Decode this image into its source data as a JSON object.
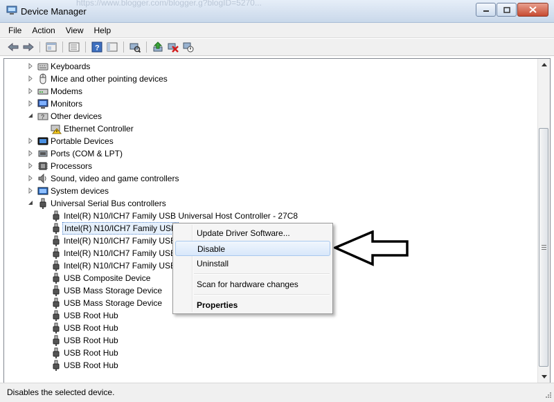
{
  "window": {
    "title": "Device Manager",
    "background_url_ghost": "https://www.blogger.com/blogger.g?blogID=5270..."
  },
  "menubar": {
    "items": [
      "File",
      "Action",
      "View",
      "Help"
    ]
  },
  "toolbar": {
    "icons": [
      "back-arrow-icon",
      "forward-arrow-icon",
      "properties-view-icon",
      "show-hide-tree-icon",
      "help-icon",
      "details-view-icon",
      "scan-hardware-icon",
      "update-driver-icon",
      "uninstall-icon",
      "disable-device-icon"
    ]
  },
  "tree": {
    "nodes": [
      {
        "label": "Keyboards",
        "level": 0,
        "expander": "collapsed",
        "icon": "keyboard-icon"
      },
      {
        "label": "Mice and other pointing devices",
        "level": 0,
        "expander": "collapsed",
        "icon": "mouse-icon"
      },
      {
        "label": "Modems",
        "level": 0,
        "expander": "collapsed",
        "icon": "modem-icon"
      },
      {
        "label": "Monitors",
        "level": 0,
        "expander": "collapsed",
        "icon": "monitor-icon"
      },
      {
        "label": "Other devices",
        "level": 0,
        "expander": "expanded",
        "icon": "other-devices-icon"
      },
      {
        "label": "Ethernet Controller",
        "level": 1,
        "expander": "none",
        "icon": "warning-device-icon"
      },
      {
        "label": "Portable Devices",
        "level": 0,
        "expander": "collapsed",
        "icon": "portable-device-icon"
      },
      {
        "label": "Ports (COM & LPT)",
        "level": 0,
        "expander": "collapsed",
        "icon": "port-icon"
      },
      {
        "label": "Processors",
        "level": 0,
        "expander": "collapsed",
        "icon": "processor-icon"
      },
      {
        "label": "Sound, video and game controllers",
        "level": 0,
        "expander": "collapsed",
        "icon": "sound-icon"
      },
      {
        "label": "System devices",
        "level": 0,
        "expander": "collapsed",
        "icon": "system-devices-icon"
      },
      {
        "label": "Universal Serial Bus controllers",
        "level": 0,
        "expander": "expanded",
        "icon": "usb-icon"
      },
      {
        "label": "Intel(R) N10/ICH7 Family USB Universal Host Controller - 27C8",
        "level": 1,
        "expander": "none",
        "icon": "usb-icon"
      },
      {
        "label": "Intel(R) N10/ICH7 Family USB",
        "level": 1,
        "expander": "none",
        "icon": "usb-icon",
        "selected": true
      },
      {
        "label": "Intel(R) N10/ICH7 Family USB",
        "level": 1,
        "expander": "none",
        "icon": "usb-icon"
      },
      {
        "label": "Intel(R) N10/ICH7 Family USB",
        "level": 1,
        "expander": "none",
        "icon": "usb-icon"
      },
      {
        "label": "Intel(R) N10/ICH7 Family USB2",
        "level": 1,
        "expander": "none",
        "icon": "usb-icon"
      },
      {
        "label": "USB Composite Device",
        "level": 1,
        "expander": "none",
        "icon": "usb-icon"
      },
      {
        "label": "USB Mass Storage Device",
        "level": 1,
        "expander": "none",
        "icon": "usb-icon"
      },
      {
        "label": "USB Mass Storage Device",
        "level": 1,
        "expander": "none",
        "icon": "usb-icon"
      },
      {
        "label": "USB Root Hub",
        "level": 1,
        "expander": "none",
        "icon": "usb-icon"
      },
      {
        "label": "USB Root Hub",
        "level": 1,
        "expander": "none",
        "icon": "usb-icon"
      },
      {
        "label": "USB Root Hub",
        "level": 1,
        "expander": "none",
        "icon": "usb-icon"
      },
      {
        "label": "USB Root Hub",
        "level": 1,
        "expander": "none",
        "icon": "usb-icon"
      },
      {
        "label": "USB Root Hub",
        "level": 1,
        "expander": "none",
        "icon": "usb-icon"
      }
    ]
  },
  "context_menu": {
    "items": [
      {
        "label": "Update Driver Software...",
        "highlighted": false,
        "bold": false
      },
      {
        "label": "Disable",
        "highlighted": true,
        "bold": false
      },
      {
        "label": "Uninstall",
        "highlighted": false,
        "bold": false
      },
      {
        "label": "Scan for hardware changes",
        "highlighted": false,
        "bold": false
      },
      {
        "label": "Properties",
        "highlighted": false,
        "bold": true
      }
    ]
  },
  "statusbar": {
    "text": "Disables the selected device."
  },
  "colors": {
    "selection_border": "#5a8ad0",
    "menu_highlight": "#d8e7fa",
    "close_button": "#c74b32"
  }
}
